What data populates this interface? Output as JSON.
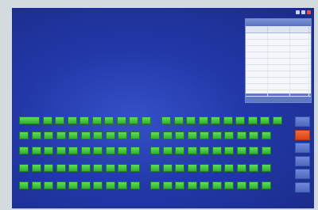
{
  "window": {
    "controls": [
      "minimize-icon",
      "maximize-icon",
      "close-icon"
    ],
    "accent": "#2238a8"
  },
  "table": {
    "title": "",
    "columns": [
      "",
      "",
      ""
    ],
    "rows": 10
  },
  "keypad": {
    "rows": [
      {
        "left_count": 10,
        "right_count": 10,
        "first_wide": true
      },
      {
        "left_count": 10,
        "right_count": 10,
        "first_wide": false
      },
      {
        "left_count": 10,
        "right_count": 10,
        "first_wide": false
      },
      {
        "left_count": 10,
        "right_count": 10,
        "first_wide": false
      },
      {
        "left_count": 10,
        "right_count": 10,
        "first_wide": false
      }
    ],
    "key_color": "#3cc83a"
  },
  "side_buttons": [
    {
      "label": "",
      "active": false
    },
    {
      "label": "",
      "active": true
    },
    {
      "label": "",
      "active": false
    },
    {
      "label": "",
      "active": false
    },
    {
      "label": "",
      "active": false
    },
    {
      "label": "",
      "active": false
    }
  ],
  "colors": {
    "active": "#e0501f",
    "button": "#5a73c8",
    "key": "#3cc83a"
  }
}
